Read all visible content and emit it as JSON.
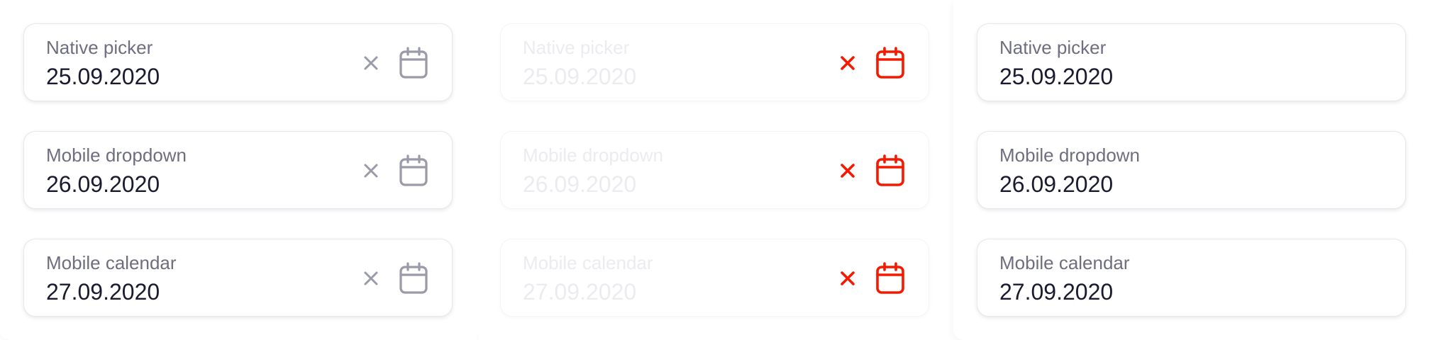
{
  "colors": {
    "icon_default": "#9a9aa8",
    "icon_error": "#f51900",
    "label": "#6e6e80",
    "value": "#1b1b2f",
    "disabled_text": "#ececf0",
    "border": "#e6e6ec"
  },
  "icons": {
    "clear": "close-icon",
    "calendar": "calendar-icon"
  },
  "columns": [
    {
      "state": "default",
      "fields": [
        {
          "label": "Native picker",
          "value": "25.09.2020"
        },
        {
          "label": "Mobile dropdown",
          "value": "26.09.2020"
        },
        {
          "label": "Mobile calendar",
          "value": "27.09.2020"
        }
      ]
    },
    {
      "state": "disabled-error",
      "fields": [
        {
          "label": "Native picker",
          "value": "25.09.2020"
        },
        {
          "label": "Mobile dropdown",
          "value": "26.09.2020"
        },
        {
          "label": "Mobile calendar",
          "value": "27.09.2020"
        }
      ]
    },
    {
      "state": "no-icons",
      "fields": [
        {
          "label": "Native picker",
          "value": "25.09.2020"
        },
        {
          "label": "Mobile dropdown",
          "value": "26.09.2020"
        },
        {
          "label": "Mobile calendar",
          "value": "27.09.2020"
        }
      ]
    }
  ]
}
